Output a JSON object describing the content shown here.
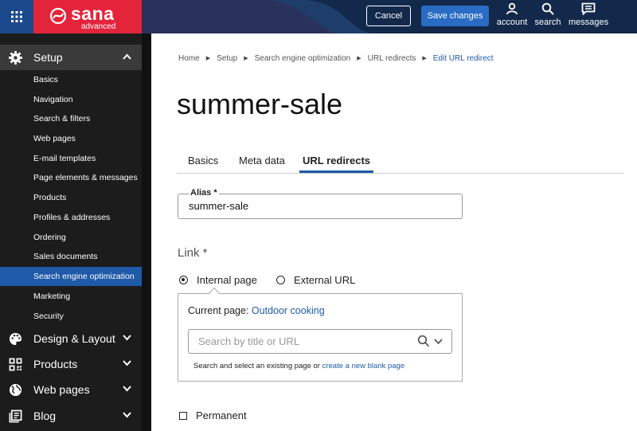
{
  "brand": {
    "name": "sana",
    "subtitle": "advanced"
  },
  "topbar": {
    "cancel_label": "Cancel",
    "save_label": "Save changes",
    "icons": [
      {
        "name": "account-icon",
        "label": "account"
      },
      {
        "name": "search-icon",
        "label": "search"
      },
      {
        "name": "messages-icon",
        "label": "messages"
      }
    ]
  },
  "sidebar": {
    "sections": [
      {
        "icon": "gear-icon",
        "label": "Setup",
        "expanded": true
      },
      {
        "icon": "palette-icon",
        "label": "Design & Layout"
      },
      {
        "icon": "qr-code-icon",
        "label": "Products"
      },
      {
        "icon": "globe-icon",
        "label": "Web pages"
      },
      {
        "icon": "blog-icon",
        "label": "Blog"
      }
    ],
    "setup_items": [
      "Basics",
      "Navigation",
      "Search & filters",
      "Web pages",
      "E-mail templates",
      "Page elements & messages",
      "Products",
      "Profiles & addresses",
      "Ordering",
      "Sales documents",
      "Search engine optimization",
      "Marketing",
      "Security"
    ],
    "active_item": "Search engine optimization"
  },
  "breadcrumb": [
    "Home",
    "Setup",
    "Search engine optimization",
    "URL redirects",
    "Edit URL redirect"
  ],
  "page_title": "summer-sale",
  "tabs": [
    {
      "label": "Basics"
    },
    {
      "label": "Meta data"
    },
    {
      "label": "URL redirects",
      "active": true
    }
  ],
  "alias": {
    "label": "Alias *",
    "value": "summer-sale"
  },
  "link": {
    "title": "Link *",
    "options": [
      {
        "label": "Internal page",
        "selected": true
      },
      {
        "label": "External URL",
        "selected": false
      }
    ],
    "current_page_label": "Current page:",
    "current_page_value": "Outdoor cooking",
    "search_placeholder": "Search by title or URL",
    "help_text": "Search and select an existing page or",
    "help_link": "create a new blank page"
  },
  "permanent": {
    "label": "Permanent",
    "checked": false
  },
  "colors": {
    "accent": "#1e5aa8",
    "brand_red": "#e4243b",
    "topbar": "#13294b",
    "sidebar": "#1c1c1c"
  }
}
